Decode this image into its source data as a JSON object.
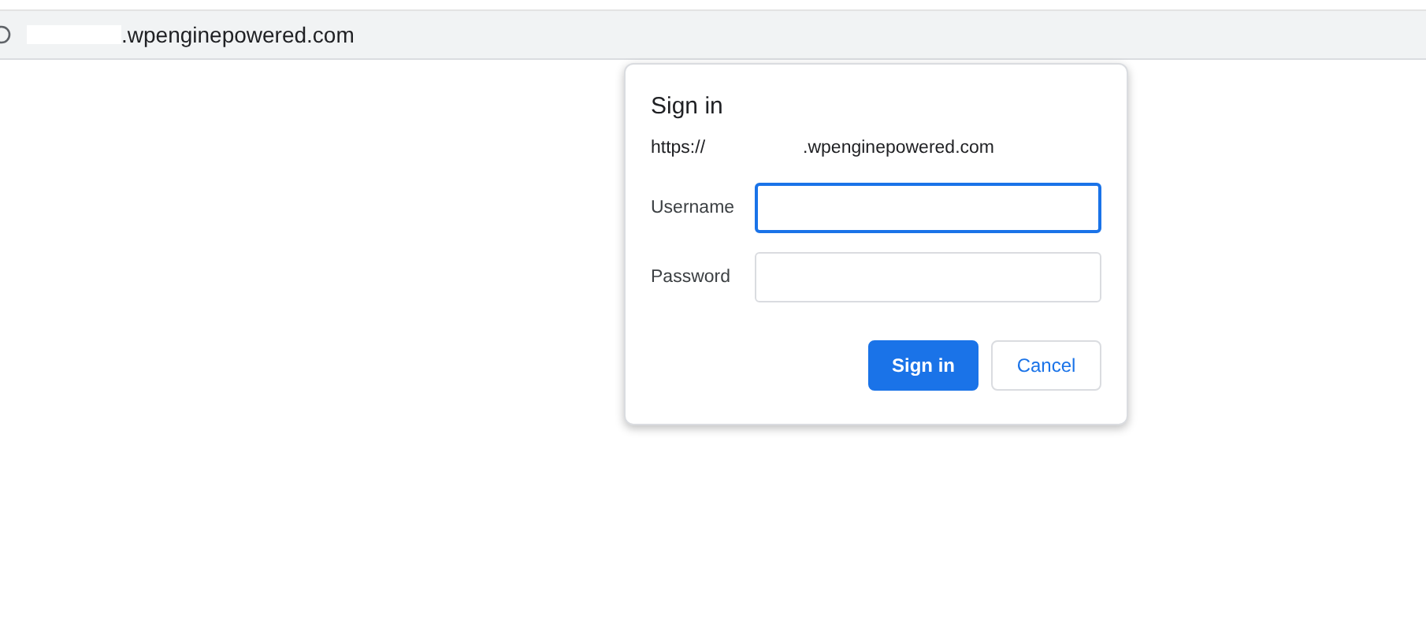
{
  "address_bar": {
    "url_tail": ".wpenginepowered.com"
  },
  "dialog": {
    "title": "Sign in",
    "origin_head": "https://",
    "origin_tail": ".wpenginepowered.com",
    "fields": [
      {
        "label": "Username",
        "focused": true
      },
      {
        "label": "Password",
        "focused": false
      }
    ],
    "buttons": [
      {
        "label": "Sign in",
        "kind": "primary"
      },
      {
        "label": "Cancel",
        "kind": "secondary"
      }
    ]
  }
}
